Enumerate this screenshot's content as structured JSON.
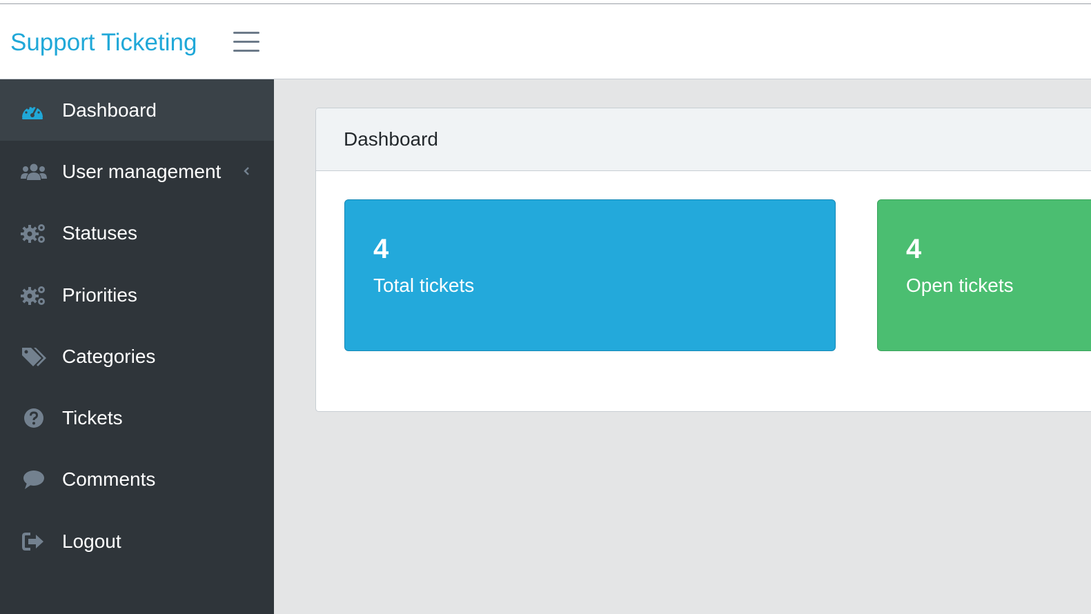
{
  "header": {
    "brand": "Support Ticketing",
    "menu_icon": "hamburger-icon"
  },
  "sidebar": {
    "items": [
      {
        "label": "Dashboard",
        "icon": "speedometer-icon",
        "active": true
      },
      {
        "label": "User management",
        "icon": "users-icon",
        "has_submenu": true
      },
      {
        "label": "Statuses",
        "icon": "gears-icon"
      },
      {
        "label": "Priorities",
        "icon": "gears-icon"
      },
      {
        "label": "Categories",
        "icon": "tags-icon"
      },
      {
        "label": "Tickets",
        "icon": "question-circle-icon"
      },
      {
        "label": "Comments",
        "icon": "comment-icon"
      },
      {
        "label": "Logout",
        "icon": "sign-out-icon"
      }
    ]
  },
  "main": {
    "card_title": "Dashboard",
    "stats": [
      {
        "value": "4",
        "label": "Total tickets",
        "color": "#23a9db"
      },
      {
        "value": "4",
        "label": "Open tickets",
        "color": "#4bbe71"
      }
    ]
  },
  "colors": {
    "accent": "#20a8d8",
    "sidebar_bg": "#2f353a",
    "sidebar_active": "#3a4248",
    "icon_gray": "#73818f"
  }
}
